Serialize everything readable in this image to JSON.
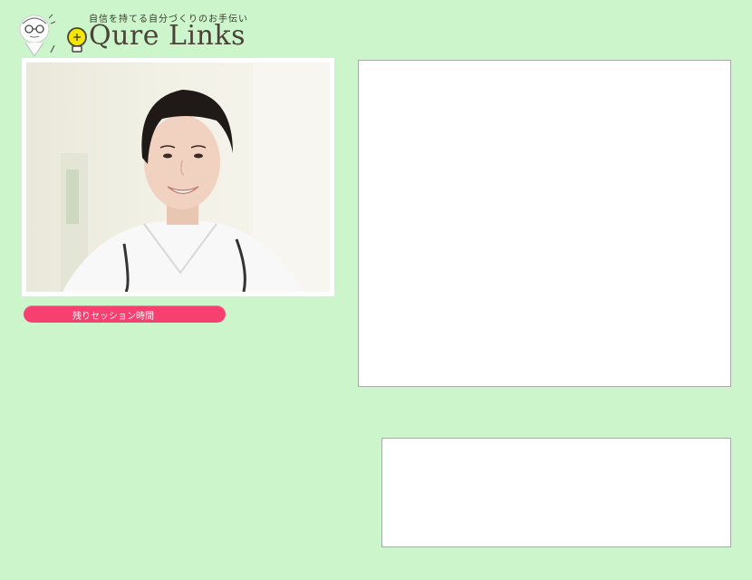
{
  "header": {
    "tagline": "自信を持てる自分づくりのお手伝い",
    "title": "Qure Links"
  },
  "session": {
    "label": "残りセッション時間",
    "color": "#f54070"
  },
  "colors": {
    "background": "#ccf5cc",
    "panel": "#ffffff",
    "panel_border": "#a9a9a9"
  },
  "icons": {
    "mascot": "doctor-mascot-icon",
    "bulb": "lightbulb-icon"
  }
}
